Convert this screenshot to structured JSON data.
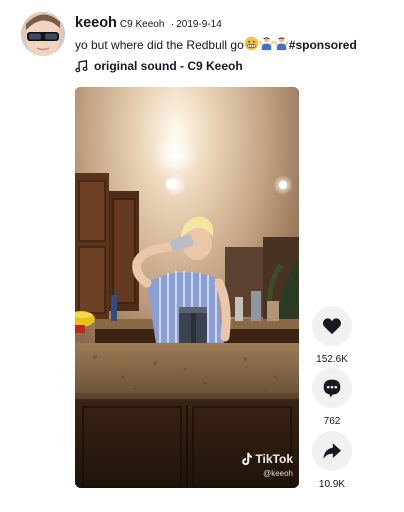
{
  "author": {
    "username": "keeoh",
    "nickname": "C9 Keeoh",
    "separator": "·",
    "date": "2019-9-14"
  },
  "caption": {
    "text": "yo but where did the Redbull go",
    "emojis": [
      "grimace-face-emoji",
      "person-shrugging-emoji",
      "person-shrugging-emoji"
    ],
    "hashtag": "#sponsored"
  },
  "sound": {
    "icon": "music-note-icon",
    "label": "original sound - C9 Keeoh"
  },
  "video": {
    "watermark_brand": "TikTok",
    "watermark_user": "@keeoh"
  },
  "actions": {
    "like_count": "152.6K",
    "comment_count": "762",
    "share_count": "10.9K"
  },
  "colors": {
    "text": "#161823",
    "action_bg": "#f1f1f2",
    "emoji_yellow": "#f5c33b",
    "emoji_blue": "#3f6fd1"
  }
}
